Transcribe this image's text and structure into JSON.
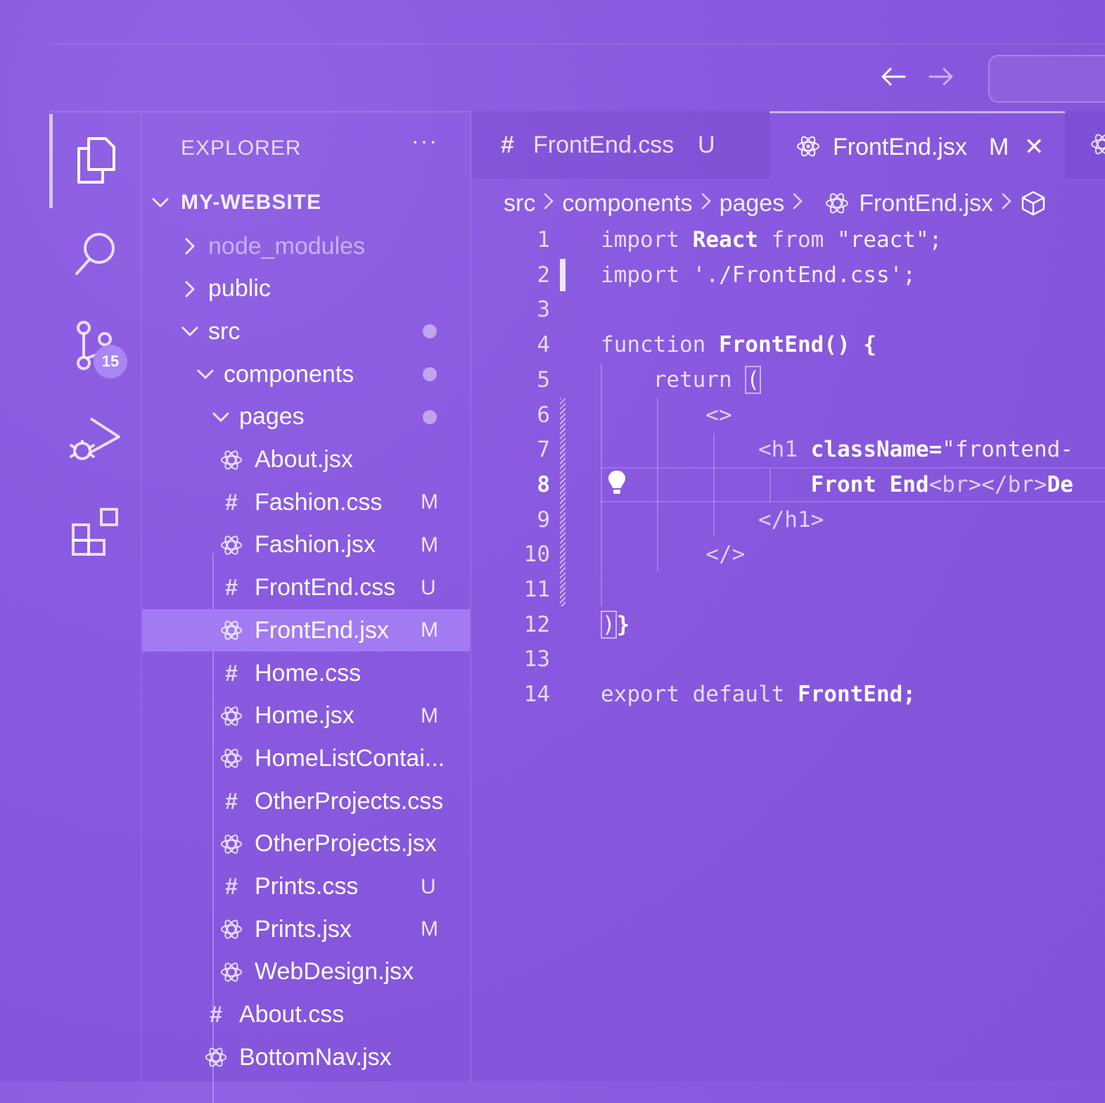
{
  "header": {
    "back_arrow": "←",
    "forward_arrow": "→"
  },
  "activity_bar": {
    "items": [
      {
        "icon": "files-icon"
      },
      {
        "icon": "search-icon"
      },
      {
        "icon": "source-control-icon",
        "badge": "15"
      },
      {
        "icon": "run-debug-icon"
      },
      {
        "icon": "extensions-icon"
      }
    ]
  },
  "sidebar": {
    "title": "EXPLORER",
    "more": "···",
    "project": "MY-WEBSITE",
    "tree": [
      {
        "label": "node_modules",
        "type": "folder",
        "open": false,
        "status": "",
        "dot": false,
        "dim": true
      },
      {
        "label": "public",
        "type": "folder",
        "open": false,
        "status": "",
        "dot": false
      },
      {
        "label": "src",
        "type": "folder",
        "open": true,
        "status": "",
        "dot": true
      },
      {
        "label": "components",
        "type": "folder",
        "open": true,
        "status": "",
        "dot": true
      },
      {
        "label": "pages",
        "type": "folder",
        "open": true,
        "status": "",
        "dot": true
      },
      {
        "label": "About.jsx",
        "type": "jsx",
        "status": ""
      },
      {
        "label": "Fashion.css",
        "type": "css",
        "status": "M"
      },
      {
        "label": "Fashion.jsx",
        "type": "jsx",
        "status": "M"
      },
      {
        "label": "FrontEnd.css",
        "type": "css",
        "status": "U"
      },
      {
        "label": "FrontEnd.jsx",
        "type": "jsx",
        "status": "M",
        "selected": true
      },
      {
        "label": "Home.css",
        "type": "css",
        "status": ""
      },
      {
        "label": "Home.jsx",
        "type": "jsx",
        "status": "M"
      },
      {
        "label": "HomeListContai...",
        "type": "jsx",
        "status": ""
      },
      {
        "label": "OtherProjects.css",
        "type": "css",
        "status": ""
      },
      {
        "label": "OtherProjects.jsx",
        "type": "jsx",
        "status": ""
      },
      {
        "label": "Prints.css",
        "type": "css",
        "status": "U"
      },
      {
        "label": "Prints.jsx",
        "type": "jsx",
        "status": "M"
      },
      {
        "label": "WebDesign.jsx",
        "type": "jsx",
        "status": ""
      },
      {
        "label": "About.css",
        "type": "css",
        "status": ""
      },
      {
        "label": "BottomNav.jsx",
        "type": "jsx",
        "status": ""
      }
    ]
  },
  "editor": {
    "tabs": [
      {
        "icon": "#",
        "label": "FrontEnd.css",
        "status": "U",
        "active": false
      },
      {
        "icon": "react",
        "label": "FrontEnd.jsx",
        "status": "M",
        "active": true,
        "close": "✕"
      }
    ],
    "breadcrumbs": [
      "src",
      "components",
      "pages",
      "FrontEnd.jsx"
    ],
    "current_line": "8",
    "lines": [
      {
        "n": "1",
        "parts": [
          [
            "kw",
            "import "
          ],
          [
            "id",
            "React"
          ],
          [
            "kw",
            " from "
          ],
          [
            "str",
            "\"react\";"
          ]
        ]
      },
      {
        "n": "2",
        "parts": [
          [
            "kw",
            "import "
          ],
          [
            "str",
            "'./FrontEnd.css';"
          ]
        ]
      },
      {
        "n": "3",
        "parts": []
      },
      {
        "n": "4",
        "parts": [
          [
            "kw",
            "function "
          ],
          [
            "id",
            "FrontEnd() {"
          ]
        ]
      },
      {
        "n": "5",
        "parts": [
          [
            "kw",
            "    return "
          ],
          [
            "box",
            "("
          ]
        ]
      },
      {
        "n": "6",
        "parts": [
          [
            "tag",
            "        <>"
          ]
        ]
      },
      {
        "n": "7",
        "parts": [
          [
            "tag",
            "            <h1 "
          ],
          [
            "id",
            "className="
          ],
          [
            "str",
            "\"frontend-"
          ]
        ]
      },
      {
        "n": "8",
        "parts": [
          [
            "id",
            "                Front End"
          ],
          [
            "tag",
            "<br></br>"
          ],
          [
            "id",
            "De"
          ]
        ]
      },
      {
        "n": "9",
        "parts": [
          [
            "tag",
            "            </h1>"
          ]
        ]
      },
      {
        "n": "10",
        "parts": [
          [
            "tag",
            "        </>"
          ]
        ]
      },
      {
        "n": "11",
        "parts": []
      },
      {
        "n": "12",
        "parts": [
          [
            "box",
            ")"
          ],
          [
            "id",
            "}"
          ]
        ]
      },
      {
        "n": "13",
        "parts": []
      },
      {
        "n": "14",
        "parts": [
          [
            "kw",
            "export default "
          ],
          [
            "id",
            "FrontEnd;"
          ]
        ]
      }
    ]
  }
}
